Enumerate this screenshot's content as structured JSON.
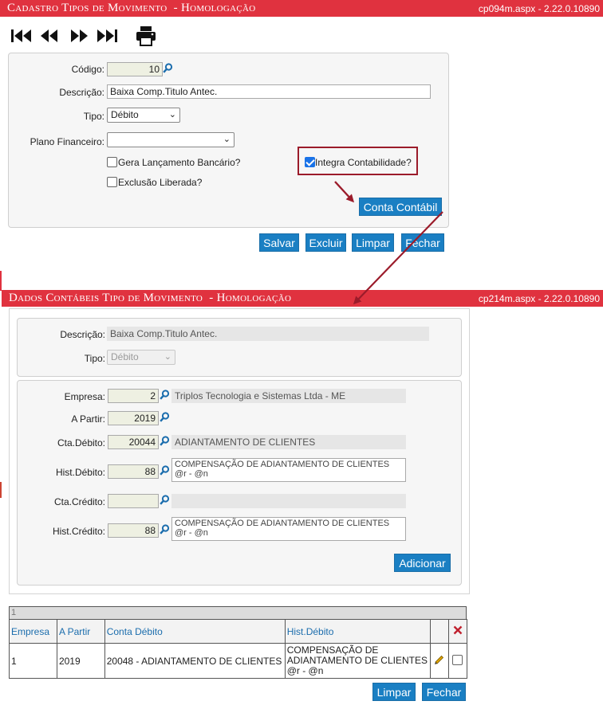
{
  "window1": {
    "title": "Cadastro Tipos de Movimento",
    "env": "- Homologação",
    "version": "cp094m.aspx - 2.22.0.10890",
    "form": {
      "codigo_label": "Código:",
      "codigo_value": "10",
      "descricao_label": "Descrição:",
      "descricao_value": "Baixa Comp.Titulo Antec.",
      "tipo_label": "Tipo:",
      "tipo_value": "Débito",
      "plano_label": "Plano Financeiro:",
      "plano_value": "",
      "gera_label": "Gera Lançamento Bancário?",
      "gera_checked": false,
      "integra_label": "Integra Contabilidade?",
      "integra_checked": true,
      "exclusao_label": "Exclusão Liberada?",
      "exclusao_checked": false,
      "conta_contabil_button": "Conta Contábil"
    },
    "buttons": {
      "salvar": "Salvar",
      "excluir": "Excluir",
      "limpar": "Limpar",
      "fechar": "Fechar"
    }
  },
  "window2": {
    "title": "Dados Contábeis Tipo de Movimento",
    "env": "- Homologação",
    "version": "cp214m.aspx - 2.22.0.10890",
    "header": {
      "descricao_label": "Descrição:",
      "descricao_value": "Baixa Comp.Titulo Antec.",
      "tipo_label": "Tipo:",
      "tipo_value": "Débito"
    },
    "form": {
      "empresa_label": "Empresa:",
      "empresa_value": "2",
      "empresa_desc": "Triplos Tecnologia e Sistemas Ltda - ME",
      "apartir_label": "A Partir:",
      "apartir_value": "2019",
      "ctadebito_label": "Cta.Débito:",
      "ctadebito_value": "20044",
      "ctadebito_desc": "ADIANTAMENTO DE CLIENTES",
      "histdebito_label": "Hist.Débito:",
      "histdebito_value": "88",
      "histdebito_desc": "COMPENSAÇÃO DE ADIANTAMENTO DE CLIENTES @r - @n",
      "ctacredito_label": "Cta.Crédito:",
      "ctacredito_value": "",
      "ctacredito_desc": "",
      "histcredito_label": "Hist.Crédito:",
      "histcredito_value": "88",
      "histcredito_desc": "COMPENSAÇÃO DE ADIANTAMENTO DE CLIENTES @r - @n",
      "adicionar_button": "Adicionar"
    },
    "grid": {
      "record_count": "1",
      "columns": [
        "Empresa",
        "A Partir",
        "Conta Débito",
        "Hist.Débito"
      ],
      "rows": [
        {
          "empresa": "1",
          "apartir": "2019",
          "conta_debito": "20048 - ADIANTAMENTO DE CLIENTES",
          "hist_debito": "COMPENSAÇÃO DE ADIANTAMENTO DE CLIENTES @r - @n"
        }
      ]
    },
    "buttons": {
      "limpar": "Limpar",
      "fechar": "Fechar"
    }
  },
  "colors": {
    "title_bar": "#e0323f",
    "button": "#1a7fc3",
    "highlight": "#9b1b2a",
    "link": "#1b6dad"
  },
  "icons": [
    "first-page-icon",
    "previous-page-icon",
    "next-page-icon",
    "last-page-icon",
    "print-icon",
    "search-icon",
    "pencil-icon",
    "delete-x-icon"
  ]
}
